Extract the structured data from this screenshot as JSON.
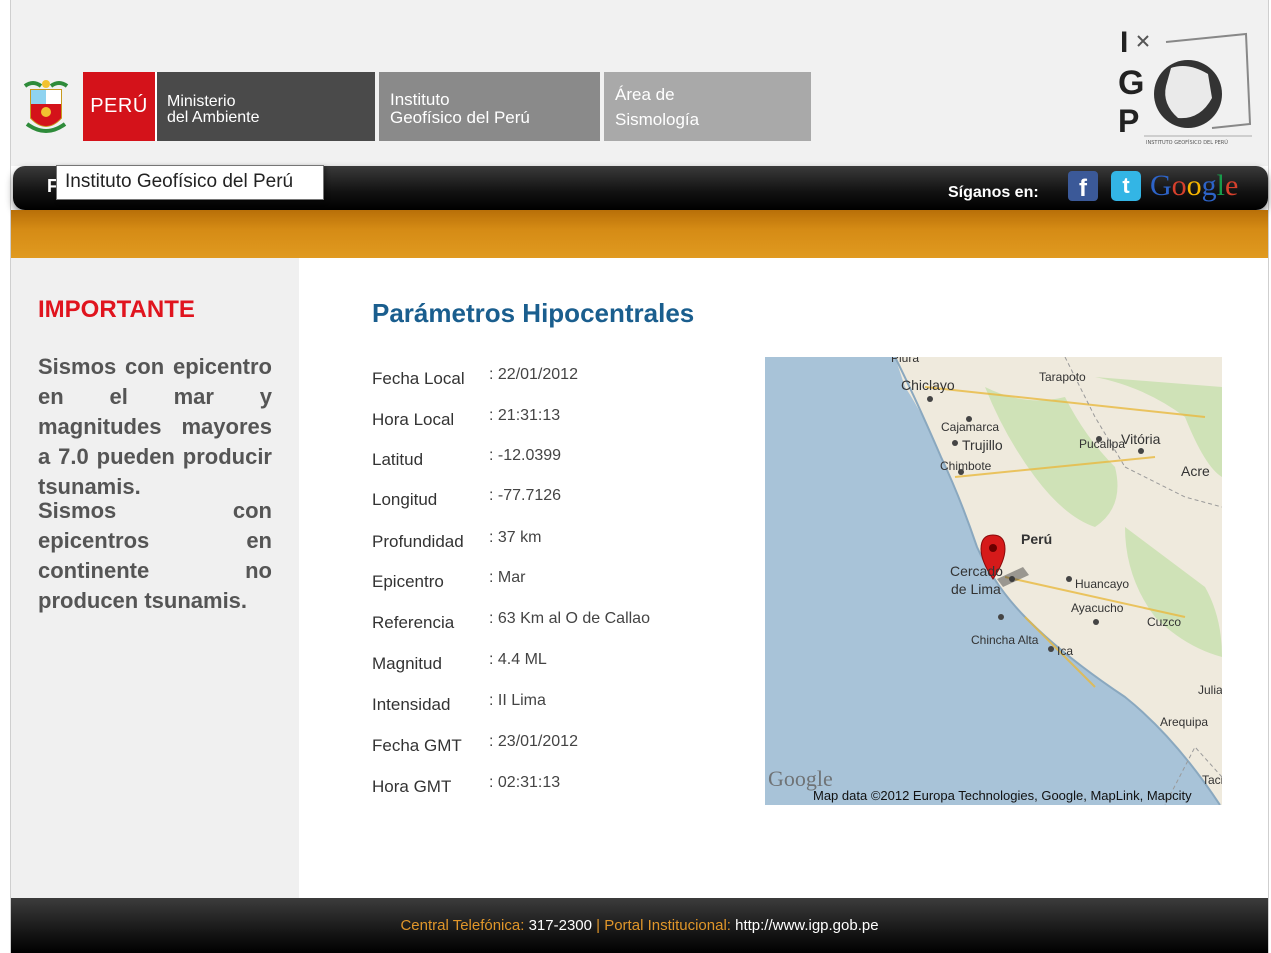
{
  "header": {
    "country": "PERÚ",
    "ministry_line1": "Ministerio",
    "ministry_line2": "del Ambiente",
    "institute_line1": "Instituto",
    "institute_line2": "Geofísico del Perú",
    "area_line1": "Área de",
    "area_line2": "Sismología",
    "logo_text": "INSTITUTO GEOFÍSICO DEL PERÚ"
  },
  "nav": {
    "first_letter": "F",
    "tooltip": "Instituto Geofísico del Perú",
    "follow_label": "Síganos en:",
    "social_icons": [
      "facebook-icon",
      "twitter-icon",
      "google-groups-icon"
    ],
    "google_groups_text": "Google"
  },
  "sidebar": {
    "title": "IMPORTANTE",
    "paragraph1": "Sismos con epicentro en el mar y magnitudes mayores a 7.0 pueden producir tsunamis.",
    "paragraph2": "Sismos con epicentros en continente no producen tsunamis."
  },
  "main": {
    "title": "Parámetros Hipocentrales",
    "params": [
      {
        "label": "Fecha Local",
        "value": ": 22/01/2012"
      },
      {
        "label": "Hora Local",
        "value": ": 21:31:13"
      },
      {
        "label": "Latitud",
        "value": ": -12.0399"
      },
      {
        "label": "Longitud",
        "value": ": -77.7126"
      },
      {
        "label": "Profundidad",
        "value": ": 37 km"
      },
      {
        "label": "Epicentro",
        "value": ": Mar"
      },
      {
        "label": "Referencia",
        "value": ": 63 Km al O de Callao"
      },
      {
        "label": "Magnitud",
        "value": ": 4.4 ML"
      },
      {
        "label": "Intensidad",
        "value": ": II Lima"
      },
      {
        "label": "Fecha GMT",
        "value": ": 23/01/2012"
      },
      {
        "label": "Hora GMT",
        "value": ": 02:31:13"
      }
    ]
  },
  "map": {
    "labels": {
      "piura": "Piura",
      "chiclayo": "Chiclayo",
      "tarapoto": "Tarapoto",
      "cajamarca": "Cajamarca",
      "trujillo": "Trujillo",
      "pucallpa": "Pucallpa",
      "vitoria": "Vitória",
      "acre": "Acre",
      "chimbote": "Chimbote",
      "peru": "Perú",
      "cercado1": "Cercado",
      "cercado2": "de Lima",
      "huancayo": "Huancayo",
      "ayacucho": "Ayacucho",
      "cuzco": "Cuzco",
      "chincha": "Chincha Alta",
      "ica": "Ica",
      "juliaca": "Julia",
      "arequipa": "Arequipa",
      "tacna": "Tacr"
    },
    "google_logo": "Google",
    "credit": "Map data ©2012 Europa Technologies, Google, MapLink, Mapcity"
  },
  "footer": {
    "phone_label": "Central Telefónica:",
    "phone_value": " 317-2300 ",
    "separator": "|",
    "portal_label": " Portal Institucional:",
    "portal_value": " http://www.igp.gob.pe"
  }
}
